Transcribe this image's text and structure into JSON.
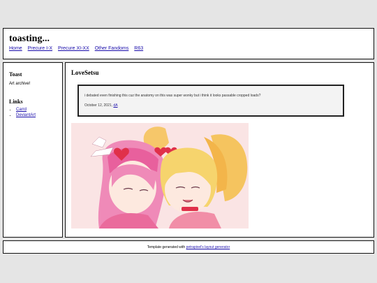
{
  "header": {
    "title": "toasting...",
    "nav": [
      "Home",
      "Precure I-X",
      "Precure XI-XX",
      "Other Fandoms",
      "R63"
    ]
  },
  "sidebar": {
    "toast_heading": "Toast",
    "toast_text": "Art archive!",
    "links_heading": "Links",
    "links": [
      "Carrd",
      "DeviantArt"
    ]
  },
  "post": {
    "title": "LoveSetsu",
    "text": "i debated even finishing this cuz the anatomy on this was super wonky but i think it looks passable cropped loads?",
    "date": "October 12, 2021,",
    "source_link": "dA"
  },
  "footer": {
    "prefix": "Template generated with",
    "link": "petrapixel's layout generator"
  },
  "colors": {
    "background": "#e5e5e5",
    "border": "#111111",
    "link": "#1a0dab",
    "art_bg": "#f9e0e0"
  }
}
